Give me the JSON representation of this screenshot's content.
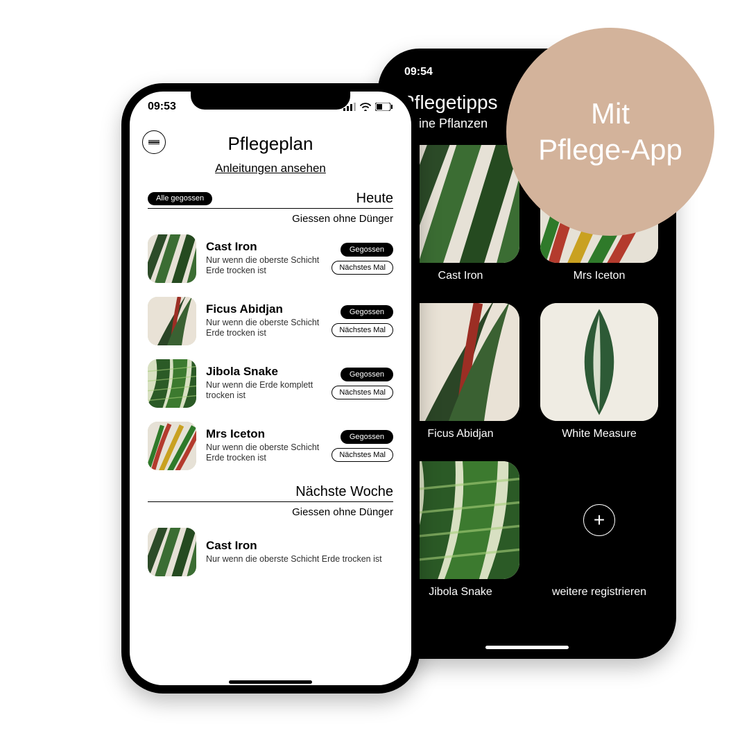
{
  "promo": {
    "text": "Mit\nPflege-App",
    "bg": "#d3b39b"
  },
  "back_phone": {
    "time": "09:54",
    "title": "Pflegetipps",
    "subtitle": "Meine Pflanzen",
    "tiles": [
      {
        "label": "Cast Iron"
      },
      {
        "label": "Mrs Iceton"
      },
      {
        "label": "Ficus Abidjan"
      },
      {
        "label": "White Measure"
      },
      {
        "label": "Jibola Snake"
      }
    ],
    "add_label": "weitere registrieren"
  },
  "front_phone": {
    "time": "09:53",
    "title": "Pflegeplan",
    "link": "Anleitungen ansehen",
    "all_done_label": "Alle gegossen",
    "sections": [
      {
        "title": "Heute",
        "subtitle": "Giessen ohne Dünger"
      },
      {
        "title": "Nächste Woche",
        "subtitle": "Giessen ohne Dünger"
      }
    ],
    "actions": {
      "primary": "Gegossen",
      "secondary": "Nächstes Mal"
    },
    "today_plants": [
      {
        "name": "Cast Iron",
        "desc": "Nur wenn die oberste Schicht Erde trocken ist"
      },
      {
        "name": "Ficus Abidjan",
        "desc": "Nur wenn die oberste Schicht Erde trocken ist"
      },
      {
        "name": "Jibola Snake",
        "desc": "Nur wenn die Erde komplett trocken ist"
      },
      {
        "name": "Mrs Iceton",
        "desc": "Nur wenn die oberste Schicht Erde trocken ist"
      }
    ],
    "next_week_plants": [
      {
        "name": "Cast Iron",
        "desc": "Nur wenn die oberste Schicht Erde trocken ist"
      }
    ]
  }
}
